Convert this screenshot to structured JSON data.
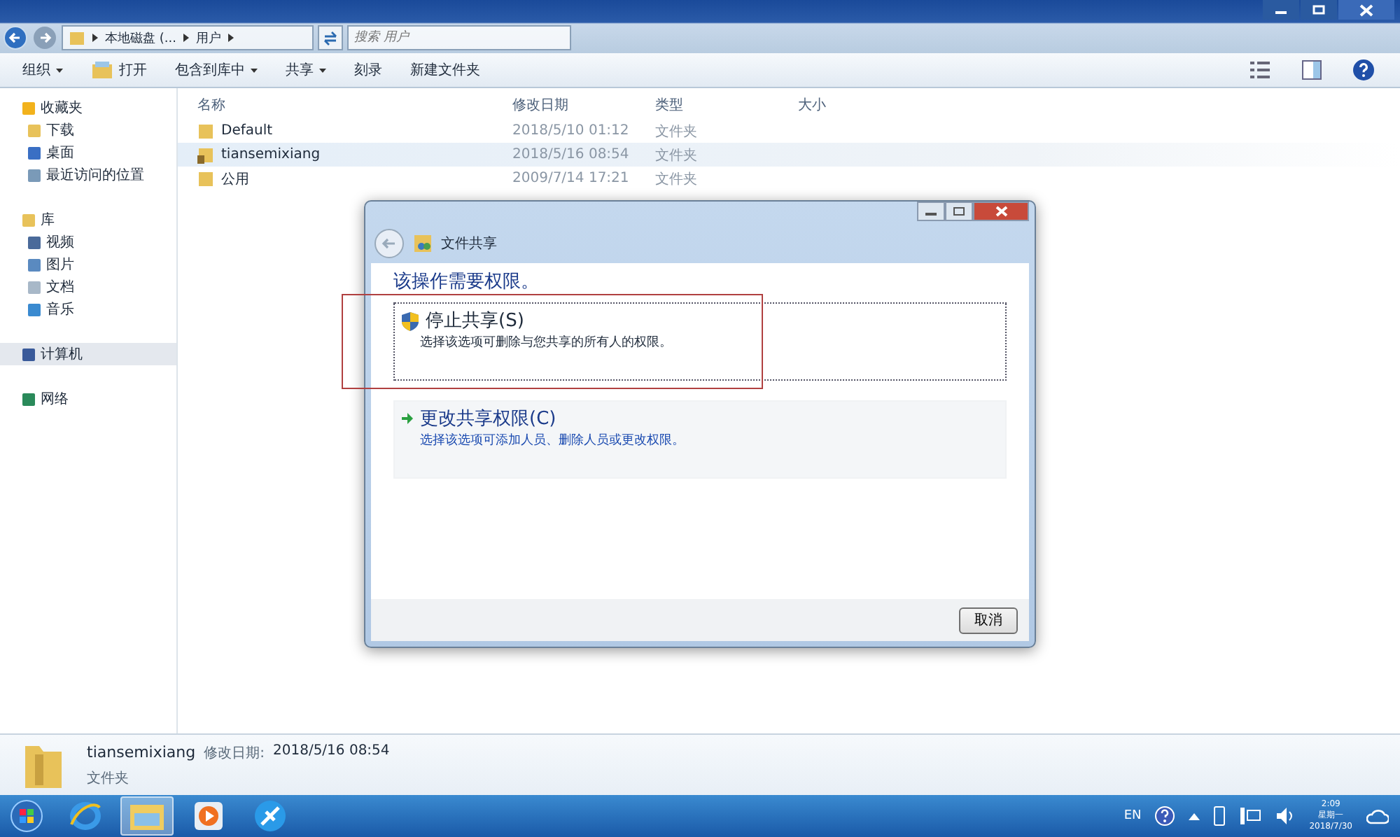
{
  "address_bar": {
    "crumbs": [
      "本地磁盘 (...",
      "用户"
    ],
    "search": {
      "placeholder": "搜索 用户"
    }
  },
  "toolbar": {
    "items": [
      {
        "label": "组织",
        "kind": "menu"
      },
      {
        "label": "打开",
        "kind": "open"
      },
      {
        "label": "包含到库中",
        "kind": "menu"
      },
      {
        "label": "共享",
        "kind": "menu"
      },
      {
        "label": "刻录",
        "kind": "plain"
      },
      {
        "label": "新建文件夹",
        "kind": "plain"
      }
    ]
  },
  "sidebar": {
    "groups": [
      {
        "label": "收藏夹",
        "kind": "star",
        "selected": false,
        "children": [
          {
            "label": "下载",
            "kind": "folder"
          },
          {
            "label": "桌面",
            "kind": "desktop"
          },
          {
            "label": "最近访问的位置",
            "kind": "recent"
          }
        ]
      },
      {
        "label": "库",
        "kind": "library",
        "selected": false,
        "children": [
          {
            "label": "视频",
            "kind": "video"
          },
          {
            "label": "图片",
            "kind": "picture"
          },
          {
            "label": "文档",
            "kind": "doc"
          },
          {
            "label": "音乐",
            "kind": "music"
          }
        ]
      },
      {
        "label": "计算机",
        "kind": "computer",
        "selected": true
      },
      {
        "label": "网络",
        "kind": "network",
        "selected": false
      }
    ]
  },
  "file_list": {
    "columns": [
      "名称",
      "修改日期",
      "类型",
      "大小"
    ],
    "rows": [
      {
        "name": "Default",
        "date": "2018/5/10 01:12",
        "type": "文件夹",
        "selected": false,
        "shared": false
      },
      {
        "name": "tiansemixiang",
        "date": "2018/5/16 08:54",
        "type": "文件夹",
        "selected": true,
        "shared": true
      },
      {
        "name": "公用",
        "date": "2009/7/14 17:21",
        "type": "文件夹",
        "selected": false,
        "shared": false
      }
    ]
  },
  "dialog": {
    "title": "文件共享",
    "heading": "该操作需要权限。",
    "options": [
      {
        "title": "停止共享(S)",
        "description": "选择该选项可删除与您共享的所有人的权限。",
        "kind": "shield",
        "selected": true,
        "highlighted": true
      },
      {
        "title": "更改共享权限(C)",
        "description": "选择该选项可添加人员、删除人员或更改权限。",
        "kind": "arrow",
        "selected": false,
        "highlighted": false
      }
    ],
    "cancel": "取消"
  },
  "details": {
    "name": "tiansemixiang",
    "date_label": "修改日期:",
    "date": "2018/5/16 08:54",
    "type": "文件夹"
  },
  "taskbar": {
    "apps": [
      {
        "kind": "ie",
        "selected": false
      },
      {
        "kind": "explorer",
        "selected": true
      },
      {
        "kind": "player",
        "selected": false
      },
      {
        "kind": "app",
        "selected": false
      }
    ],
    "tray": {
      "language": "EN",
      "time": "2:09",
      "weekday": "星期一",
      "date": "2018/7/30"
    }
  }
}
